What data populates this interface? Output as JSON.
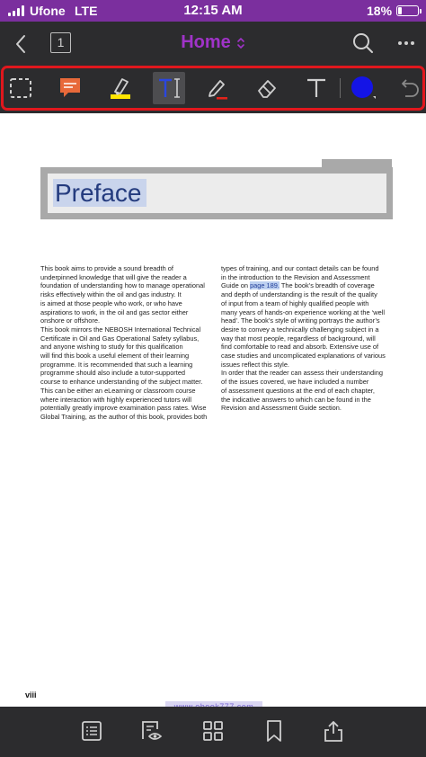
{
  "status_bar": {
    "carrier": "Ufone",
    "network": "LTE",
    "time": "12:15 AM",
    "battery_percent": "18%",
    "battery_level": 0.18
  },
  "header": {
    "back_icon": "chevron-left-icon",
    "page_count": "1",
    "title": "Home",
    "title_icon": "chevron-up-down-icon",
    "search_icon": "search-icon",
    "more_icon": "ellipsis-icon"
  },
  "toolbar": {
    "tools": [
      {
        "name": "select-area-tool",
        "icon": "dashed-rectangle-icon"
      },
      {
        "name": "comment-tool",
        "icon": "speech-bubble-icon"
      },
      {
        "name": "highlight-tool",
        "icon": "highlighter-icon"
      },
      {
        "name": "text-markup-tool",
        "icon": "text-cursor-icon",
        "active": true
      },
      {
        "name": "pen-tool",
        "icon": "pencil-icon"
      },
      {
        "name": "eraser-tool",
        "icon": "eraser-icon"
      },
      {
        "name": "text-box-tool",
        "icon": "text-icon"
      },
      {
        "name": "color-picker",
        "icon": "color-dot-icon"
      },
      {
        "name": "undo-button",
        "icon": "undo-icon"
      }
    ],
    "colors": {
      "comment": "#e8693a",
      "highlighter": "#ffe500",
      "text_markup": "#2a46e0",
      "pen": "#e2231a",
      "current_color": "#1414e6",
      "selection_outline": "#e0171d"
    }
  },
  "document": {
    "title": "Preface",
    "left_column": [
      "This book aims to provide a sound breadth of",
      "underpinned knowledge that will give the reader a",
      "foundation of understanding how to manage operational",
      "risks effectively within the oil and gas industry. It",
      "is aimed at those people who work, or who have",
      "aspirations to work, in the oil and gas sector either",
      "onshore or offshore.",
      "This book mirrors the NEBOSH International Technical",
      "Certificate in Oil and Gas Operational Safety syllabus,",
      "and anyone wishing to study for this qualification",
      "will find this book a useful element of their learning",
      "programme. It is recommended that such a learning",
      "programme should also include a tutor-supported",
      "course to enhance understanding of the subject matter.",
      "This can be either an eLearning or classroom course",
      "where interaction with highly experienced tutors will",
      "potentially greatly improve examination pass rates. Wise",
      "Global Training, as the author of this book, provides both"
    ],
    "right_column": {
      "line1": "types of training, and our contact details can be found",
      "line2": "in the introduction to the Revision and Assessment",
      "line3_before": "Guide on ",
      "line3_link": "page 189.",
      "line3_after": " The book’s breadth of coverage",
      "rest": [
        "and depth of understanding is the result of the quality",
        "of input from a team of highly qualified people with",
        "many years of hands-on experience working at the ‘well",
        "head’. The book’s style of writing portrays the author’s",
        "desire to convey a technically challenging subject in a",
        "way that most people, regardless of background, will",
        "find comfortable to read and absorb. Extensive use of",
        "case studies and uncomplicated explanations of various",
        "issues reflect this style.",
        "In order that the reader can assess their understanding",
        "of the issues covered, we have included a number",
        "of assessment questions at the end of each chapter,",
        "the indicative answers to which can be found in the",
        "Revision and Assessment Guide section."
      ]
    },
    "page_number": "viii",
    "watermark": "www.ebook777.com"
  },
  "bottom_bar": {
    "items": [
      {
        "name": "outline-button",
        "icon": "list-icon"
      },
      {
        "name": "reading-mode-button",
        "icon": "page-eye-icon"
      },
      {
        "name": "thumbnails-button",
        "icon": "grid-icon"
      },
      {
        "name": "bookmark-button",
        "icon": "bookmark-icon"
      },
      {
        "name": "share-button",
        "icon": "share-icon"
      }
    ]
  }
}
